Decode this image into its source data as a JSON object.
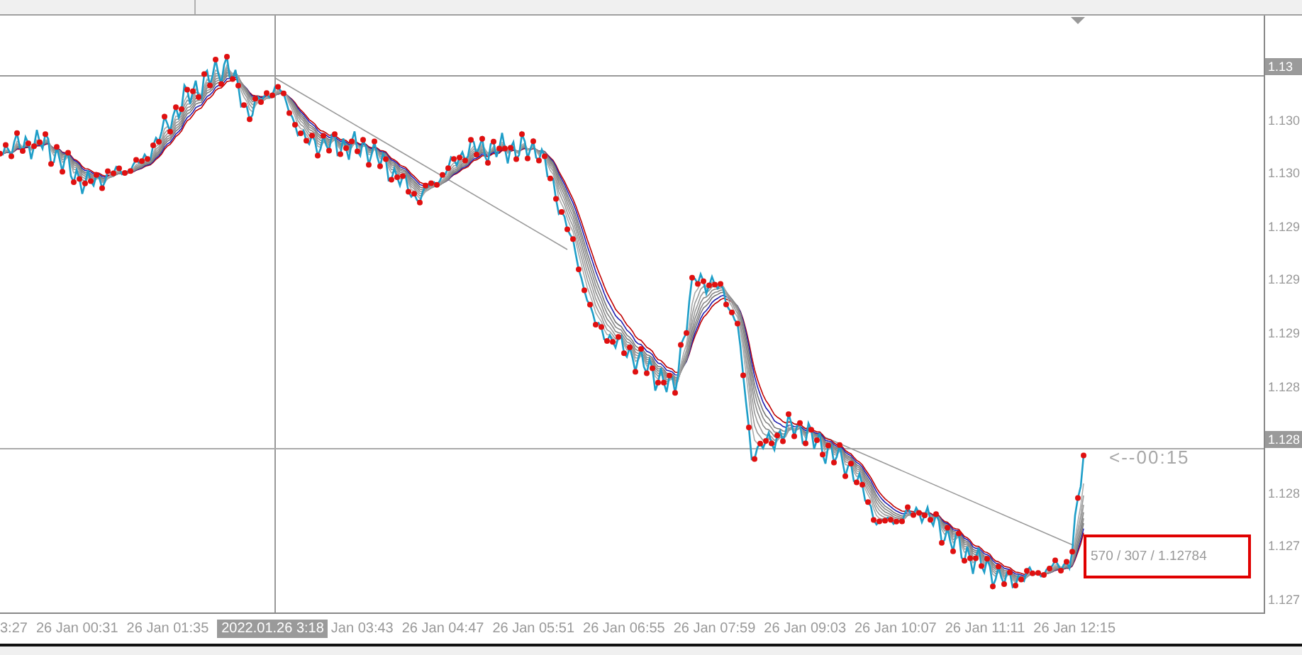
{
  "chart": {
    "countdown": "<--00:15",
    "info_box": "570 / 307 / 1.12784"
  },
  "price_axis": [
    {
      "label": "1.13",
      "kind": "crosshair"
    },
    {
      "label": "1.130",
      "kind": "tick"
    },
    {
      "label": "1.130",
      "kind": "tick"
    },
    {
      "label": "1.129",
      "kind": "tick"
    },
    {
      "label": "1.129",
      "kind": "tick"
    },
    {
      "label": "1.129",
      "kind": "tick"
    },
    {
      "label": "1.128",
      "kind": "tick"
    },
    {
      "label": "1.128",
      "kind": "current"
    },
    {
      "label": "1.128",
      "kind": "tick"
    },
    {
      "label": "1.127",
      "kind": "tick"
    },
    {
      "label": "1.127",
      "kind": "tick"
    }
  ],
  "time_axis": [
    {
      "label": "3:27",
      "kind": "tick"
    },
    {
      "label": "26 Jan 00:31",
      "kind": "tick"
    },
    {
      "label": "26 Jan 01:35",
      "kind": "tick"
    },
    {
      "label": "2022.01.26 3:18",
      "kind": "crosshair"
    },
    {
      "label": "Jan 03:43",
      "kind": "tick"
    },
    {
      "label": "26 Jan 04:47",
      "kind": "tick"
    },
    {
      "label": "26 Jan 05:51",
      "kind": "tick"
    },
    {
      "label": "26 Jan 06:55",
      "kind": "tick"
    },
    {
      "label": "26 Jan 07:59",
      "kind": "tick"
    },
    {
      "label": "26 Jan 09:03",
      "kind": "tick"
    },
    {
      "label": "26 Jan 10:07",
      "kind": "tick"
    },
    {
      "label": "26 Jan 11:11",
      "kind": "tick"
    },
    {
      "label": "26 Jan 12:15",
      "kind": "tick"
    }
  ]
}
